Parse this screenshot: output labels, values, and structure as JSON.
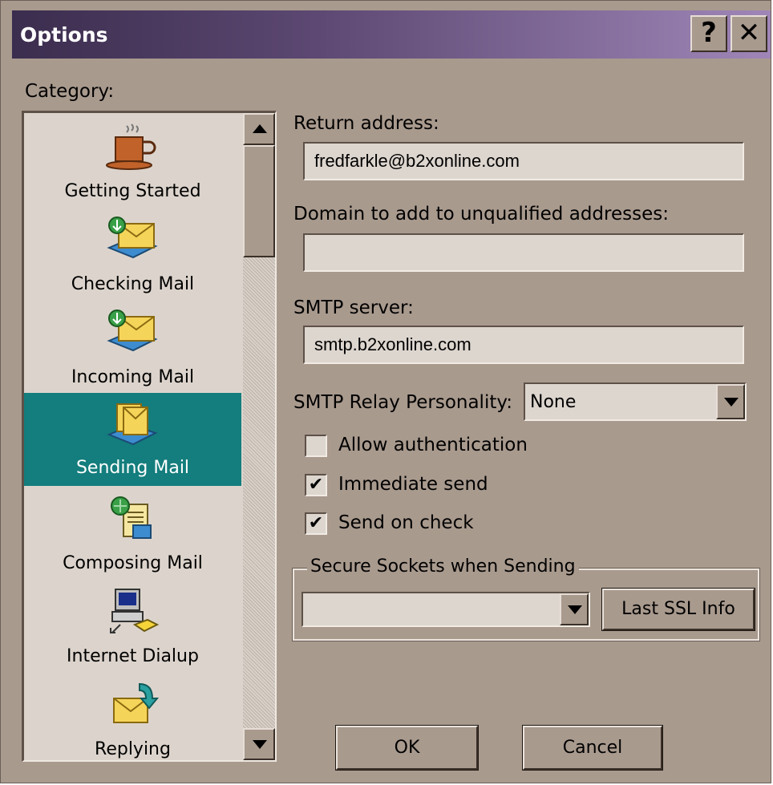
{
  "window": {
    "title": "Options",
    "help_symbol": "?",
    "close_symbol": "✕"
  },
  "category": {
    "label": "Category:",
    "items": [
      {
        "label": "Getting Started",
        "icon": "coffee-cup-icon"
      },
      {
        "label": "Checking Mail",
        "icon": "mail-download-icon"
      },
      {
        "label": "Incoming Mail",
        "icon": "mail-download-icon"
      },
      {
        "label": "Sending Mail",
        "icon": "mail-send-icon",
        "selected": true
      },
      {
        "label": "Composing Mail",
        "icon": "compose-document-icon"
      },
      {
        "label": "Internet Dialup",
        "icon": "computer-phone-icon"
      },
      {
        "label": "Replying",
        "icon": "reply-envelope-icon"
      }
    ]
  },
  "form": {
    "return_address_label": "Return address:",
    "return_address_value": "fredfarkle@b2xonline.com",
    "domain_label": "Domain to add to unqualified addresses:",
    "domain_value": "",
    "smtp_server_label": "SMTP server:",
    "smtp_server_value": "smtp.b2xonline.com",
    "relay_label": "SMTP Relay Personality:",
    "relay_value": "None",
    "allow_auth_label": "Allow authentication",
    "allow_auth_checked": false,
    "immediate_send_label": "Immediate send",
    "immediate_send_checked": true,
    "send_on_check_label": "Send on check",
    "send_on_check_checked": true,
    "ssl_group_title": "Secure Sockets when Sending",
    "ssl_value": "",
    "last_ssl_label": "Last SSL Info"
  },
  "buttons": {
    "ok": "OK",
    "cancel": "Cancel"
  },
  "colors": {
    "dialog_bg": "#a99a8e",
    "selection": "#147d7d",
    "title_gradient_start": "#3b2d4e",
    "title_gradient_end": "#9f86b7"
  }
}
